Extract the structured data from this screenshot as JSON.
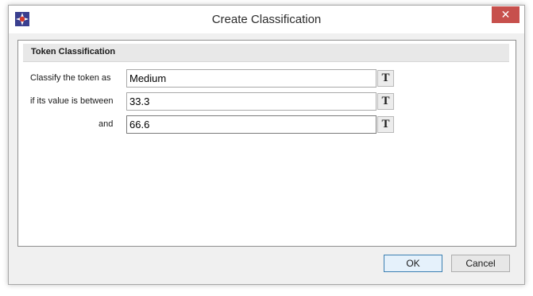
{
  "window": {
    "title": "Create Classification",
    "close_glyph": "✕",
    "accent_close": "#c7504c"
  },
  "group": {
    "header": "Token Classification"
  },
  "rows": [
    {
      "label": "Classify the token as",
      "value": "Medium",
      "button": "T"
    },
    {
      "label": "if its value is between",
      "value": "33.3",
      "button": "T"
    },
    {
      "label": "and",
      "value": "66.6",
      "button": "T"
    }
  ],
  "buttons": {
    "ok": "OK",
    "cancel": "Cancel"
  },
  "icons": {
    "app": "app-logo-icon",
    "close": "close-icon",
    "text": "text-format-icon"
  }
}
